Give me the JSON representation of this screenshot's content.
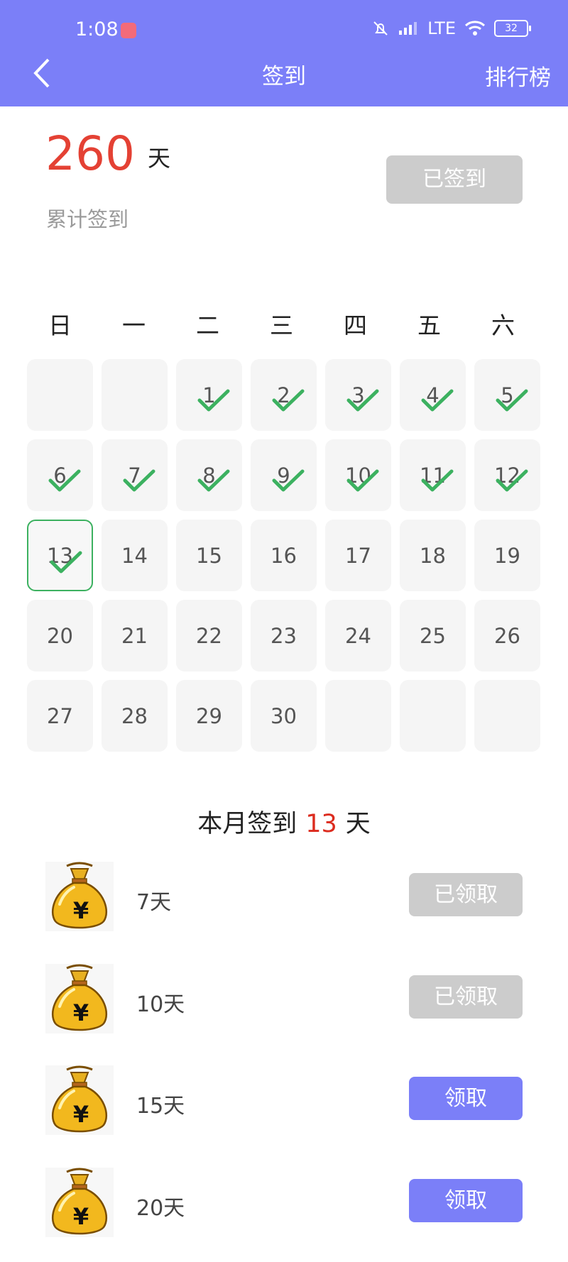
{
  "status_bar": {
    "time": "1:08",
    "network": "LTE",
    "battery": "32"
  },
  "header": {
    "title": "签到",
    "ranking": "排行榜"
  },
  "summary": {
    "total_days": "260",
    "unit": "天",
    "label": "累计签到",
    "button": "已签到"
  },
  "weekdays": [
    "日",
    "一",
    "二",
    "三",
    "四",
    "五",
    "六"
  ],
  "calendar": {
    "cells": [
      "",
      "",
      "1",
      "2",
      "3",
      "4",
      "5",
      "6",
      "7",
      "8",
      "9",
      "10",
      "11",
      "12",
      "13",
      "14",
      "15",
      "16",
      "17",
      "18",
      "19",
      "20",
      "21",
      "22",
      "23",
      "24",
      "25",
      "26",
      "27",
      "28",
      "29",
      "30",
      "",
      "",
      ""
    ],
    "signed_through": 13,
    "today": 13
  },
  "month": {
    "prefix": "本月签到",
    "count": "13",
    "suffix": "天"
  },
  "rewards": [
    {
      "label": "7天",
      "button": "已领取",
      "claimed": true
    },
    {
      "label": "10天",
      "button": "已领取",
      "claimed": true
    },
    {
      "label": "15天",
      "button": "领取",
      "claimed": false
    },
    {
      "label": "20天",
      "button": "领取",
      "claimed": false
    }
  ],
  "colors": {
    "header": "#7b7ff8",
    "accent_red": "#e44134",
    "check_green": "#3cb160",
    "disabled": "#cccccc"
  },
  "icons": {
    "back": "chevron-left-icon",
    "check": "check-icon",
    "bag": "money-bag-icon"
  }
}
